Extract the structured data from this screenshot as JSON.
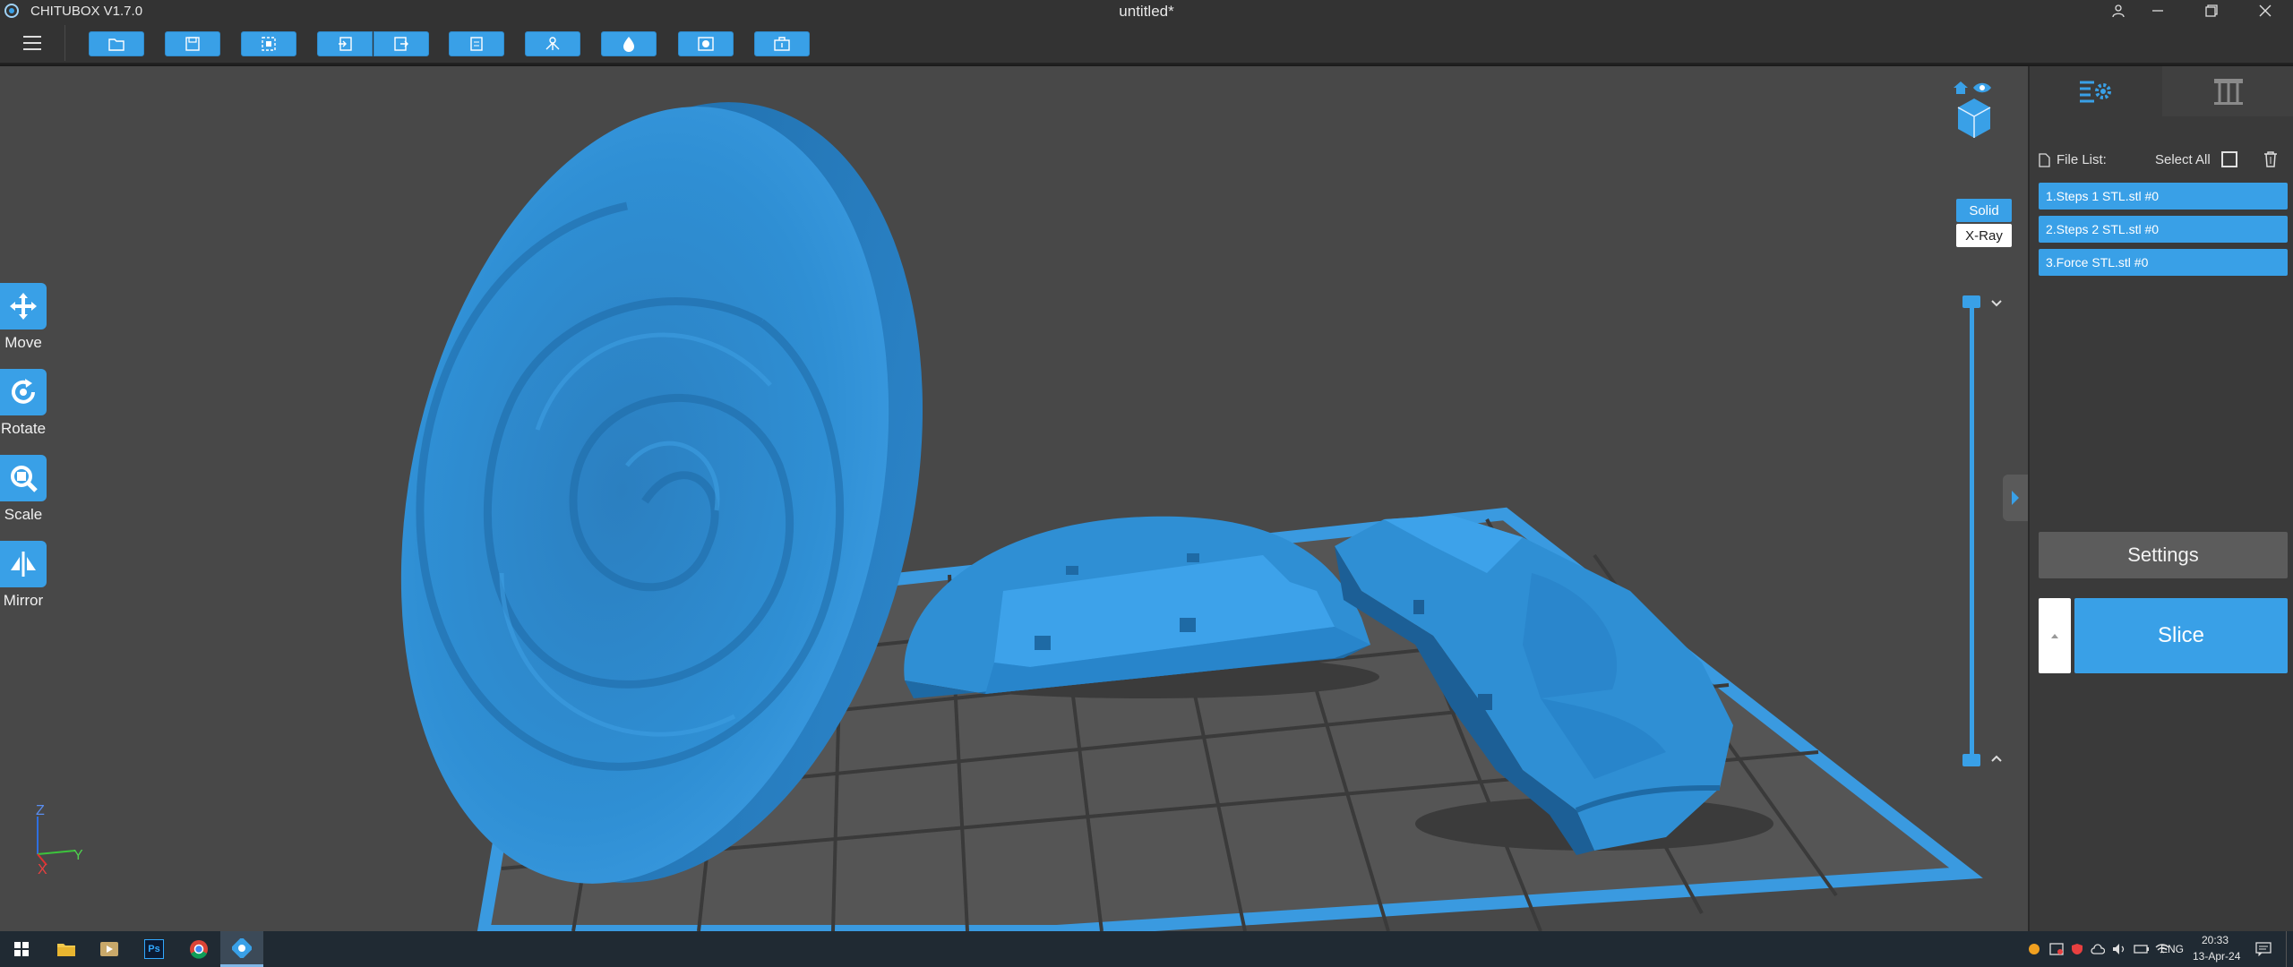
{
  "app": {
    "name": "CHITUBOX V1.7.0",
    "document_title": "untitled*"
  },
  "window_controls": {
    "account": "account-icon",
    "minimize": "minimize-icon",
    "restore": "restore-icon",
    "close": "close-icon"
  },
  "toolbar": {
    "buttons": [
      "open-file-icon",
      "save-icon",
      "select-icon",
      "import-icon",
      "export-icon",
      "edit-icon",
      "supports-icon",
      "hollow-icon",
      "dig-hole-icon",
      "auto-layout-icon"
    ]
  },
  "tools": [
    {
      "label": "Move",
      "icon": "move-icon"
    },
    {
      "label": "Rotate",
      "icon": "rotate-icon"
    },
    {
      "label": "Scale",
      "icon": "scale-icon"
    },
    {
      "label": "Mirror",
      "icon": "mirror-icon"
    }
  ],
  "view_mode": {
    "solid": "Solid",
    "xray": "X-Ray",
    "selected": "Solid"
  },
  "axis": {
    "z": "Z",
    "y": "Y",
    "x": "X"
  },
  "panel": {
    "file_list_label": "File List:",
    "select_all_label": "Select All",
    "files": [
      "1.Steps 1 STL.stl #0",
      "2.Steps 2 STL.stl #0",
      "3.Force STL.stl #0"
    ],
    "settings_label": "Settings",
    "slice_label": "Slice"
  },
  "taskbar": {
    "apps": [
      "windows-start-icon",
      "file-explorer-icon",
      "media-player-icon",
      "photoshop-icon",
      "chrome-icon",
      "chitubox-icon"
    ],
    "photoshop_text": "Ps",
    "language": "ENG",
    "time": "20:33",
    "date": "13-Apr-24"
  },
  "colors": {
    "accent": "#39a0e7",
    "model": "#2f8fd4",
    "viewport": "#484848",
    "panel": "#3a3a3a"
  }
}
